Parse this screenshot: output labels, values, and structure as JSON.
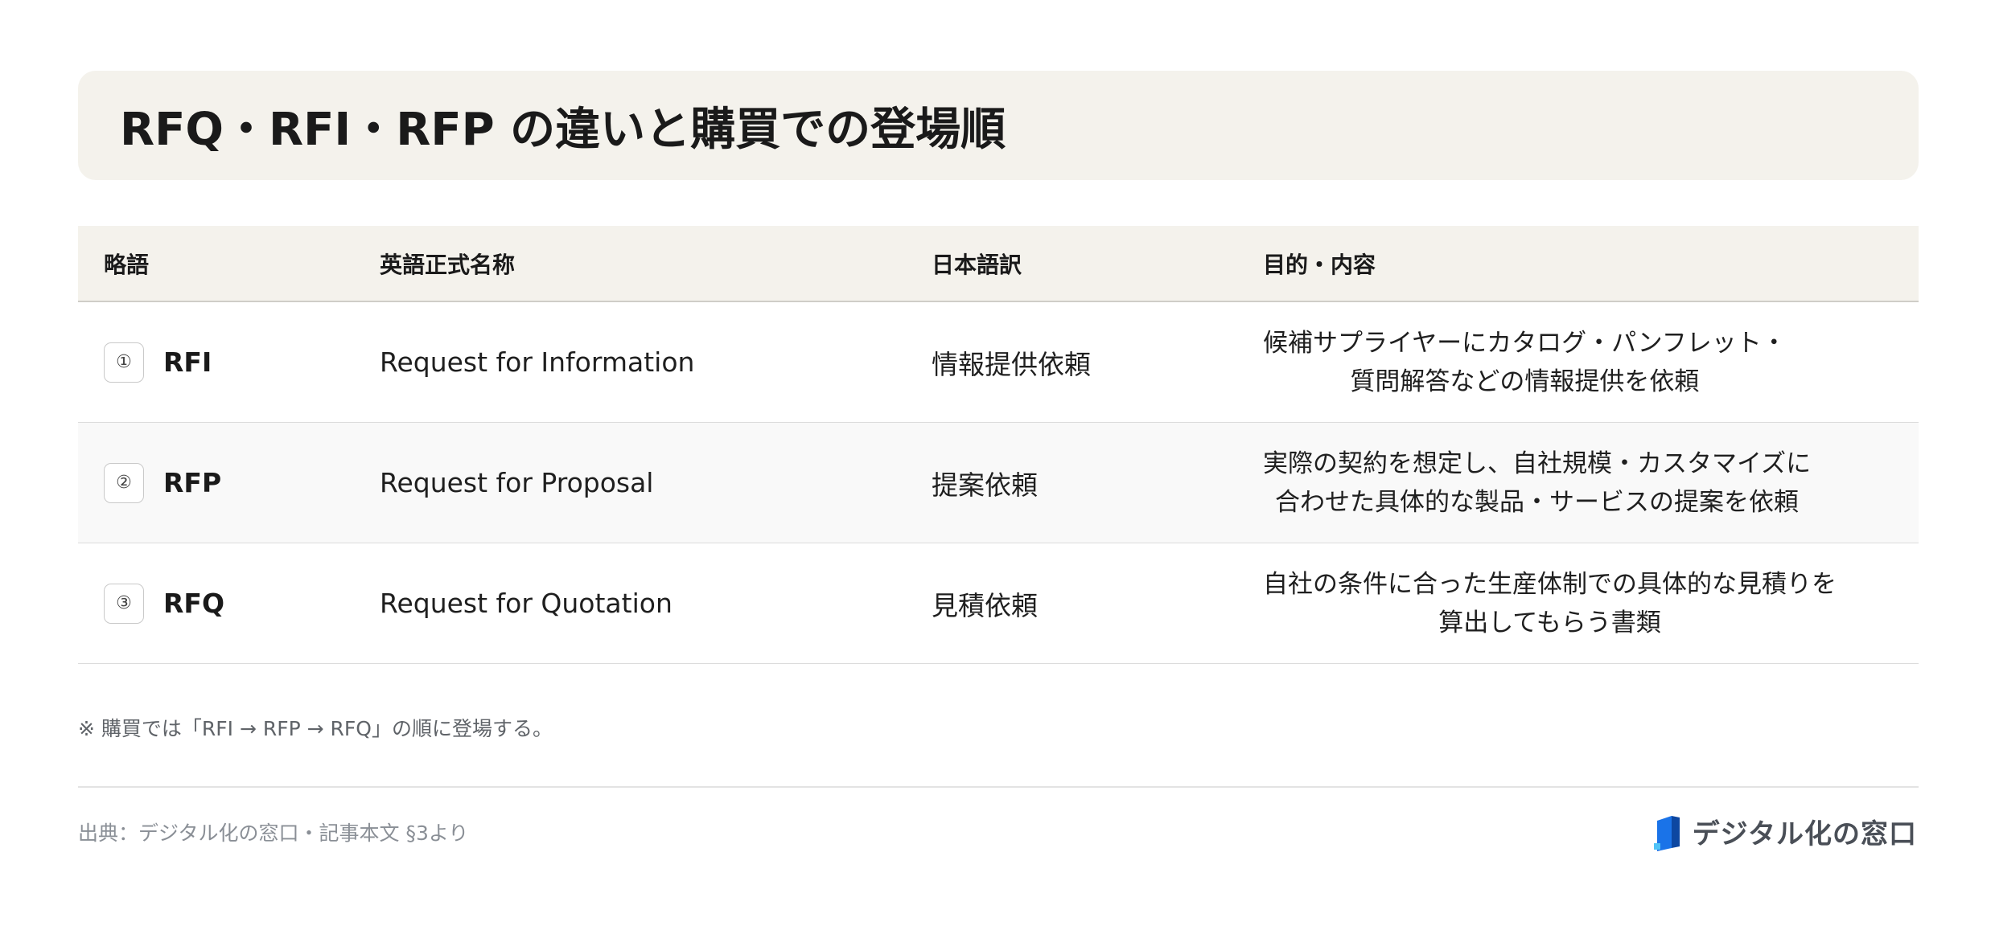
{
  "title": "RFQ・RFI・RFP の違いと購買での登場順",
  "table": {
    "headers": [
      "略語",
      "英語正式名称",
      "日本語訳",
      "目的・内容"
    ],
    "rows": [
      {
        "num": "①",
        "abbr": "RFI",
        "english": "Request for Information",
        "japanese": "情報提供依頼",
        "purpose_line1": "候補サプライヤーにカタログ・パンフレット・",
        "purpose_line2": "質問解答などの情報提供を依頼"
      },
      {
        "num": "②",
        "abbr": "RFP",
        "english": "Request for Proposal",
        "japanese": "提案依頼",
        "purpose_line1": "実際の契約を想定し、自社規模・カスタマイズに",
        "purpose_line2": "合わせた具体的な製品・サービスの提案を依頼"
      },
      {
        "num": "③",
        "abbr": "RFQ",
        "english": "Request for Quotation",
        "japanese": "見積依頼",
        "purpose_line1": "自社の条件に合った生産体制での具体的な見積りを",
        "purpose_line2": "算出してもらう書類"
      }
    ]
  },
  "note": "※ 購買では「RFI → RFP → RFQ」の順に登場する。",
  "source": "出典：デジタル化の窓口・記事本文 §3より",
  "brand": {
    "name": "デジタル化の窓口",
    "logo_icon": "book-icon",
    "logo_color": "#1a73e8"
  },
  "colors": {
    "header_bg": "#f4f2ec",
    "alt_row_bg": "#f9f9f9"
  }
}
